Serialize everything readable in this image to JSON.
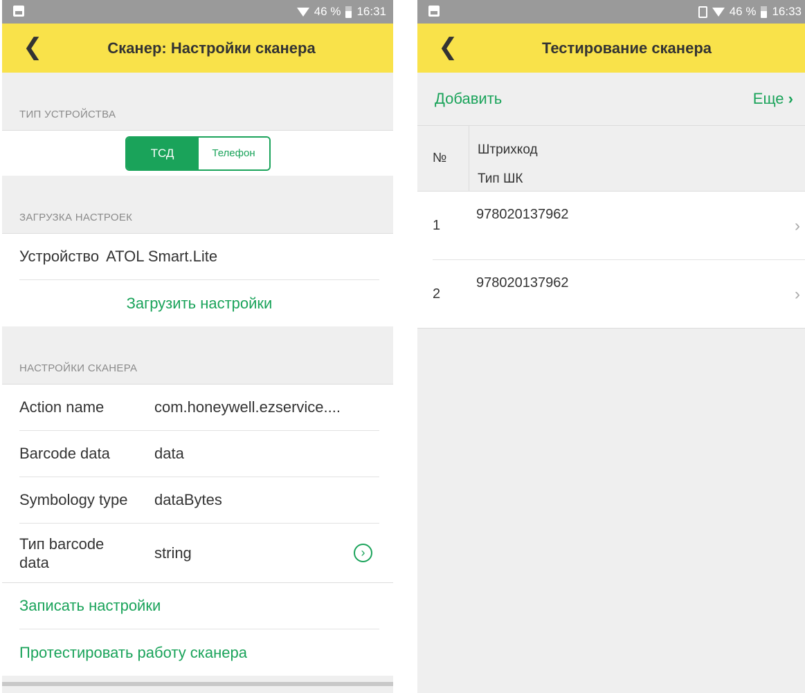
{
  "left": {
    "status": {
      "battery": "46 %",
      "time": "16:31"
    },
    "title": "Сканер: Настройки сканера",
    "device_type": {
      "heading": "ТИП УСТРОЙСТВА",
      "option_tsd": "ТСД",
      "option_phone": "Телефон"
    },
    "load": {
      "heading": "ЗАГРУЗКА НАСТРОЕК",
      "device_label": "Устройство",
      "device_value": "ATOL Smart.Lite",
      "load_button": "Загрузить настройки"
    },
    "scanner": {
      "heading": "НАСТРОЙКИ СКАНЕРА",
      "rows": [
        {
          "label": "Action name",
          "value": "com.honeywell.ezservice...."
        },
        {
          "label": "Barcode data",
          "value": "data"
        },
        {
          "label": "Symbology type",
          "value": "dataBytes"
        },
        {
          "label": "Тип barcode data",
          "value": "string"
        }
      ],
      "save_button": "Записать настройки",
      "test_button": "Протестировать работу сканера"
    }
  },
  "right": {
    "status": {
      "battery": "46 %",
      "time": "16:33"
    },
    "title": "Тестирование сканера",
    "toolbar": {
      "add": "Добавить",
      "more": "Еще"
    },
    "table": {
      "col_no": "№",
      "col_barcode": "Штрихкод",
      "col_type": "Тип ШК",
      "rows": [
        {
          "no": "1",
          "barcode": "978020137962"
        },
        {
          "no": "2",
          "barcode": "978020137962"
        }
      ]
    }
  },
  "colors": {
    "accent": "#1aa35a",
    "appbar": "#f9e24a",
    "statusbar": "#9a9a9a"
  }
}
